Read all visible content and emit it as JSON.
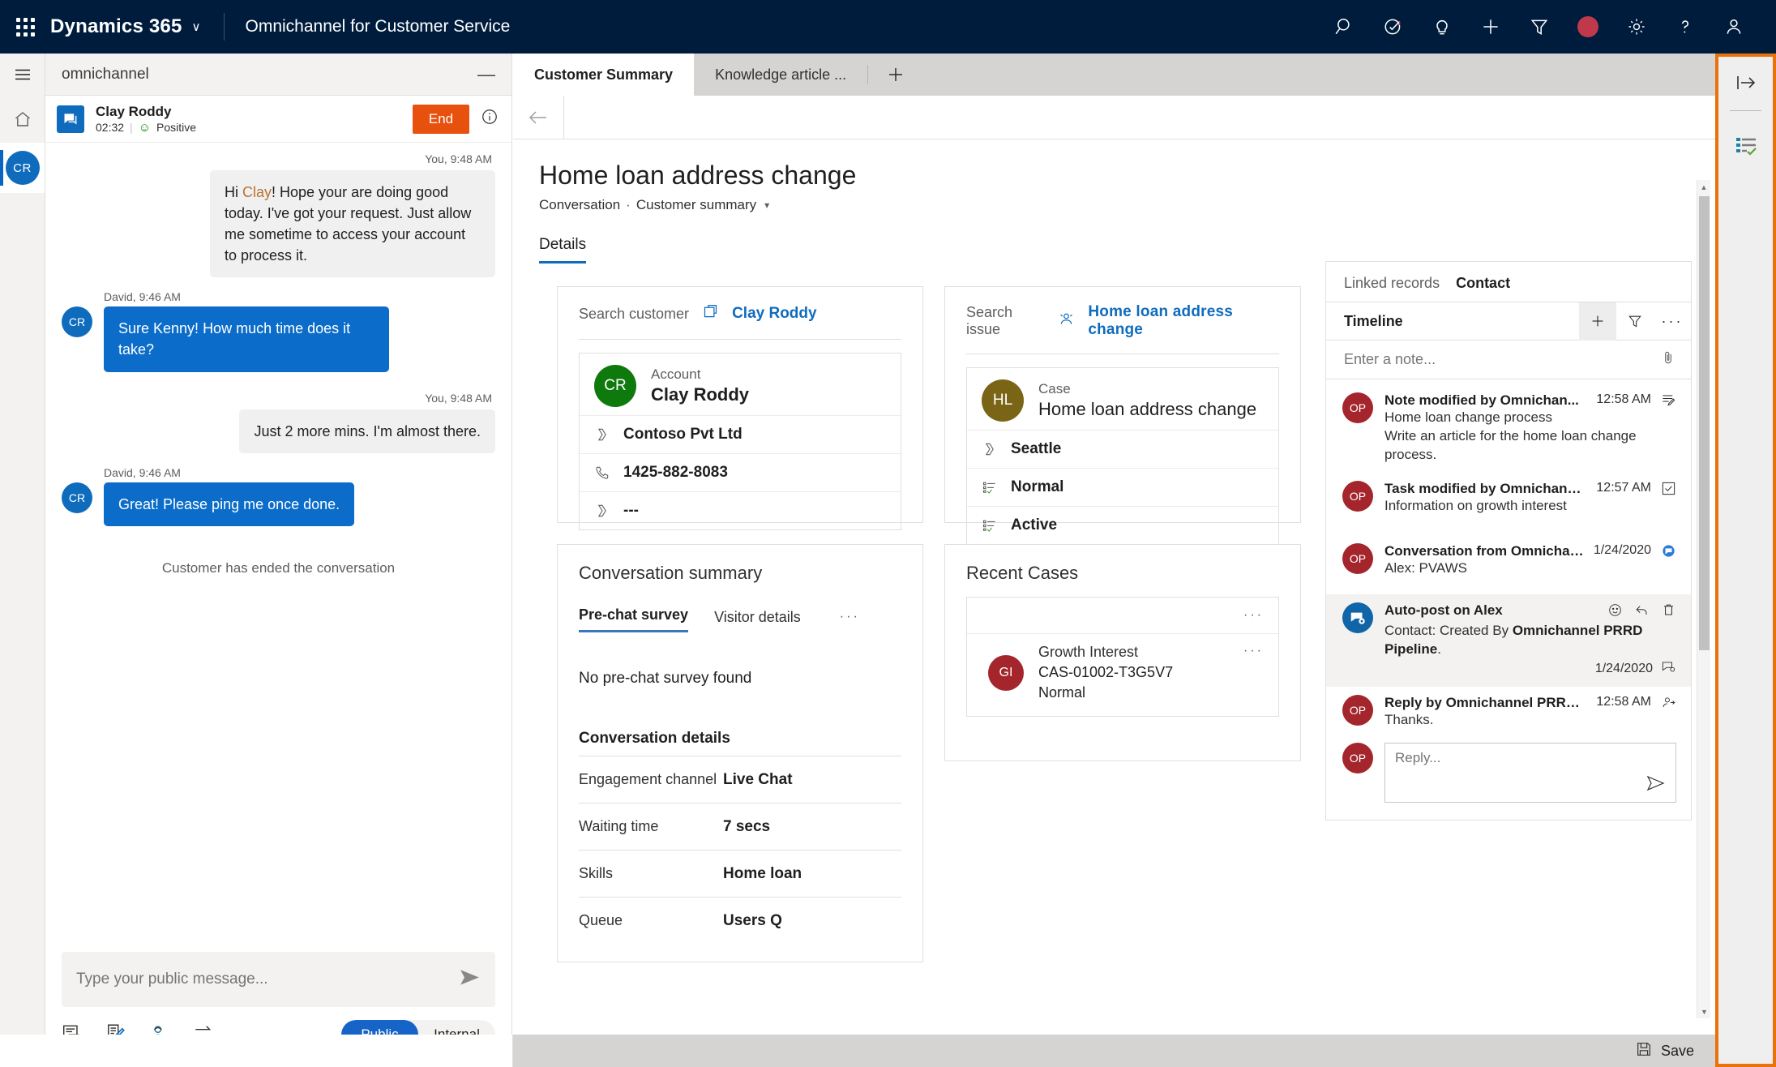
{
  "topnav": {
    "waffle_label": "app-launcher",
    "brand": "Dynamics 365",
    "chevron": "∨",
    "app_name": "Omnichannel for Customer Service",
    "icons": [
      "search-icon",
      "assign-icon",
      "insights-icon",
      "add-icon",
      "filter-icon",
      "presence-icon",
      "settings-icon",
      "help-icon",
      "user-icon"
    ]
  },
  "leftrail": {
    "hamburger": "site-map-icon",
    "home": "home-icon",
    "session_avatar": "CR"
  },
  "chat": {
    "panel_title": "omnichannel",
    "minimize": "—",
    "customer_name": "Clay Roddy",
    "duration": "02:32",
    "separator": "|",
    "sentiment": "Positive",
    "end_label": "End",
    "messages": [
      {
        "direction": "out",
        "stamp": "You, 9:48 AM",
        "text_prefix": "Hi ",
        "text_highlight": "Clay",
        "text_rest": "! Hope your are doing good today. I've got your request. Just allow me sometime to access your account to process it."
      },
      {
        "direction": "in",
        "avatar": "CR",
        "stamp": "David, 9:46 AM",
        "text": "Sure Kenny! How much time does it take?"
      },
      {
        "direction": "out",
        "stamp": "You, 9:48 AM",
        "text": "Just 2 more mins. I'm almost there."
      },
      {
        "direction": "in",
        "avatar": "CR",
        "stamp": "David, 9:46 AM",
        "text": "Great! Please ping me once done."
      }
    ],
    "system_note": "Customer has ended the conversation",
    "composer_placeholder": "Type your public message...",
    "tools": [
      "quick-replies-icon",
      "notes-icon",
      "consult-icon",
      "transfer-icon"
    ],
    "mode_public": "Public",
    "mode_internal": "Internal"
  },
  "main": {
    "tabs": [
      {
        "label": "Customer Summary",
        "active": true
      },
      {
        "label": "Knowledge article ...",
        "active": false
      }
    ],
    "tab_add": "+",
    "back_icon": "back-arrow-icon",
    "record_title": "Home loan address change",
    "breadcrumb_entity": "Conversation",
    "breadcrumb_sep": "·",
    "breadcrumb_form": "Customer summary",
    "details_tab": "Details"
  },
  "customer_card": {
    "search_label": "Search customer",
    "search_value": "Clay Roddy",
    "entity_label": "Account",
    "entity_name": "Clay Roddy",
    "avatar_initials": "CR",
    "avatar_color": "#0e7a0d",
    "rows": [
      {
        "icon": "text-field-icon",
        "value": "Contoso Pvt Ltd"
      },
      {
        "icon": "phone-icon",
        "value": "1425-882-8083"
      },
      {
        "icon": "text-field-icon",
        "value": "---"
      }
    ]
  },
  "case_card": {
    "search_label": "Search issue",
    "search_value": "Home loan address change",
    "entity_label": "Case",
    "entity_name": "Home loan address change",
    "avatar_initials": "HL",
    "avatar_color": "#7a6516",
    "rows": [
      {
        "icon": "text-field-icon",
        "value": "Seattle"
      },
      {
        "icon": "optionset-icon",
        "value": "Normal"
      },
      {
        "icon": "optionset-icon",
        "value": "Active"
      }
    ]
  },
  "conversation_summary": {
    "heading": "Conversation summary",
    "tabs": [
      {
        "label": "Pre-chat survey",
        "active": true
      },
      {
        "label": "Visitor details",
        "active": false
      }
    ],
    "overflow": "···",
    "empty_message": "No pre-chat survey found",
    "details_heading": "Conversation details",
    "details": [
      {
        "key": "Engagement channel",
        "value": "Live Chat"
      },
      {
        "key": "Waiting time",
        "value": "7 secs"
      },
      {
        "key": "Skills",
        "value": "Home loan"
      },
      {
        "key": "Queue",
        "value": "Users Q"
      }
    ]
  },
  "recent_cases": {
    "heading": "Recent Cases",
    "toolbar_overflow": "···",
    "items": [
      {
        "avatar_initials": "GI",
        "title": "Growth Interest",
        "number": "CAS-01002-T3G5V7",
        "priority": "Normal",
        "overflow": "···"
      }
    ]
  },
  "timeline": {
    "tabs": [
      {
        "label": "Linked records",
        "active": false
      },
      {
        "label": "Contact",
        "active": true
      }
    ],
    "title": "Timeline",
    "add_icon": "add-icon",
    "filter_icon": "filter-icon",
    "more_icon": "more-icon",
    "note_placeholder": "Enter a note...",
    "attach_icon": "attachment-icon",
    "items": [
      {
        "avatar": "OP",
        "avatar_type": "op",
        "title": "Note modified by Omnichan...",
        "time": "12:58 AM",
        "icon": "note-icon",
        "desc_line1": "Home loan change process",
        "desc_line2": "Write an article for the home loan change process."
      },
      {
        "avatar": "OP",
        "avatar_type": "op",
        "title": "Task modified by Omnichann...",
        "time": "12:57 AM",
        "icon": "task-check-icon",
        "desc_line1": "Information on growth interest",
        "desc_line2": ""
      },
      {
        "avatar": "OP",
        "avatar_type": "op",
        "title": "Conversation from Omnichan...",
        "time": "1/24/2020",
        "icon": "conversation-icon",
        "desc_line1": "Alex: PVAWS",
        "desc_line2": ""
      },
      {
        "avatar": "auto",
        "avatar_type": "auto",
        "highlighted": true,
        "title": "Auto-post on Alex",
        "time": "1/24/2020",
        "icon": "autopost-icon",
        "desc_prefix": "Contact: Created By ",
        "desc_bold": "Omnichannel PRRD Pipeline",
        "desc_suffix": ".",
        "actions": [
          "emoji-icon",
          "reply-icon",
          "delete-icon"
        ]
      },
      {
        "avatar": "OP",
        "avatar_type": "op",
        "title": "Reply by Omnichannel PRRD Pipeline",
        "time": "12:58 AM",
        "icon": "post-reply-icon",
        "desc_line1": "Thanks.",
        "desc_line2": ""
      }
    ],
    "reply_avatar": "OP",
    "reply_placeholder": "Reply...",
    "reply_send_icon": "send-icon"
  },
  "right_sidebar": {
    "expand_icon": "expand-panel-icon",
    "agent_script_icon": "agent-script-icon",
    "highlight_color": "#e8730c"
  },
  "savebar": {
    "icon": "save-icon",
    "label": "Save"
  },
  "scrollbar": {
    "up": "▲",
    "down": "▼"
  }
}
